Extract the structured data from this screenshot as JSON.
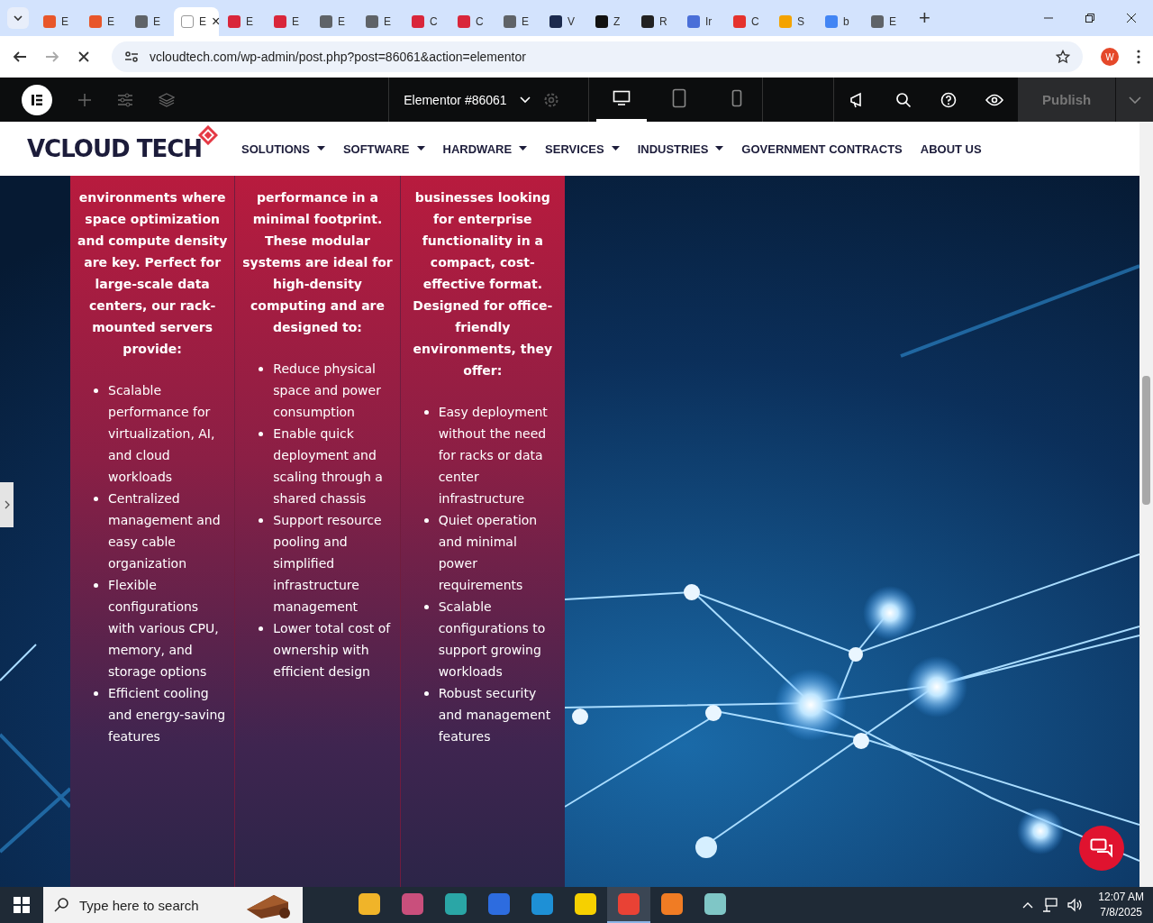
{
  "browser": {
    "tabs": [
      {
        "title": "E",
        "color": "#e8562a",
        "selected": false
      },
      {
        "title": "E",
        "color": "#e8562a",
        "selected": false
      },
      {
        "title": "E",
        "color": "#5f6368",
        "selected": false
      },
      {
        "title": "E",
        "color": "#ffffff",
        "selected": true
      },
      {
        "title": "E",
        "color": "#d9263b",
        "selected": false
      },
      {
        "title": "E",
        "color": "#d9263b",
        "selected": false
      },
      {
        "title": "E",
        "color": "#5f6368",
        "selected": false
      },
      {
        "title": "E",
        "color": "#5f6368",
        "selected": false
      },
      {
        "title": "C",
        "color": "#d9263b",
        "selected": false
      },
      {
        "title": "C",
        "color": "#d9263b",
        "selected": false
      },
      {
        "title": "E",
        "color": "#5f6368",
        "selected": false
      },
      {
        "title": "V",
        "color": "#1b2a4e",
        "selected": false
      },
      {
        "title": "Z",
        "color": "#111111",
        "selected": false
      },
      {
        "title": "R",
        "color": "#222222",
        "selected": false
      },
      {
        "title": "Ir",
        "color": "#4a6fd8",
        "selected": false
      },
      {
        "title": "C",
        "color": "#e5322d",
        "selected": false
      },
      {
        "title": "S",
        "color": "#f4a300",
        "selected": false
      },
      {
        "title": "b",
        "color": "#4285f4",
        "selected": false
      },
      {
        "title": "E",
        "color": "#5f6368",
        "selected": false
      }
    ],
    "close_tab": "×",
    "new_tab": "+",
    "url": "vcloudtech.com/wp-admin/post.php?post=86061&action=elementor",
    "profile": "W"
  },
  "editor": {
    "document": "Elementor #86061",
    "devices": [
      {
        "kind": "desktop",
        "selected": true
      },
      {
        "kind": "tablet",
        "selected": false
      },
      {
        "kind": "mobile",
        "selected": false
      }
    ],
    "publish": "Publish"
  },
  "site": {
    "logo": "VCLOUD TECH",
    "nav": [
      {
        "label": "SOLUTIONS",
        "dropdown": true
      },
      {
        "label": "SOFTWARE",
        "dropdown": true
      },
      {
        "label": "HARDWARE",
        "dropdown": true
      },
      {
        "label": "SERVICES",
        "dropdown": true
      },
      {
        "label": "INDUSTRIES",
        "dropdown": true
      },
      {
        "label": "GOVERNMENT CONTRACTS",
        "dropdown": false
      },
      {
        "label": "ABOUT US",
        "dropdown": false
      }
    ]
  },
  "columns": [
    {
      "intro": "environments where space optimization and compute density are key. Perfect for large-scale data centers, our rack-mounted servers provide:",
      "bullets": [
        "Scalable performance for virtualization, AI, and cloud workloads",
        "Centralized management and easy cable organization",
        "Flexible configurations with various CPU, memory, and storage options",
        "Efficient cooling and energy-saving features"
      ]
    },
    {
      "intro": "performance in a minimal footprint. These modular systems are ideal for high-density computing and are designed to:",
      "bullets": [
        "Reduce physical space and power consumption",
        "Enable quick deployment and scaling through a shared chassis",
        "Support resource pooling and simplified infrastructure management",
        "Lower total cost of ownership with efficient design"
      ]
    },
    {
      "intro": "businesses looking for enterprise functionality in a compact, cost-effective format. Designed for office-friendly environments, they offer:",
      "bullets": [
        "Easy deployment without the need for racks or data center infrastructure",
        "Quiet operation and minimal power requirements",
        "Scalable configurations to support growing workloads",
        "Robust security and management features"
      ]
    }
  ],
  "taskbar": {
    "search": {
      "placeholder": "Type here to search"
    },
    "time": "12:07 AM",
    "date": "7/8/2025"
  }
}
